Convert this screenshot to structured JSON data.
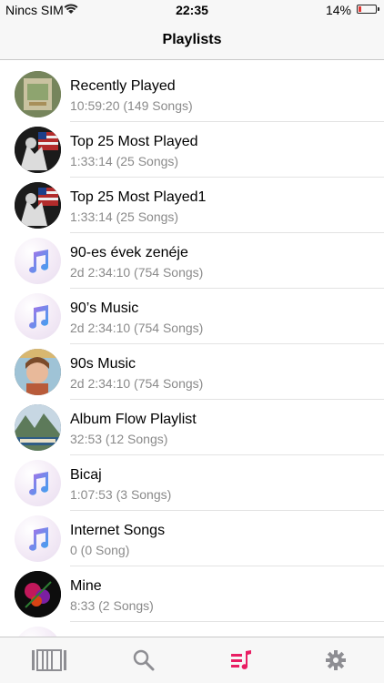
{
  "status_bar": {
    "carrier": "Nincs SIM",
    "time": "22:35",
    "battery_percent": "14%",
    "battery_level": 0.14
  },
  "nav": {
    "title": "Playlists"
  },
  "playlists": [
    {
      "name": "Recently Played",
      "meta": "10:59:20 (149 Songs)",
      "artwork": "photo-art"
    },
    {
      "name": "Top 25 Most Played",
      "meta": "1:33:14 (25 Songs)",
      "artwork": "photo-art"
    },
    {
      "name": "Top 25 Most Played1",
      "meta": "1:33:14 (25 Songs)",
      "artwork": "photo-art"
    },
    {
      "name": "90-es évek zenéje",
      "meta": "2d 2:34:10 (754 Songs)",
      "artwork": "music-note-icon"
    },
    {
      "name": "90’s Music",
      "meta": "2d 2:34:10 (754 Songs)",
      "artwork": "music-note-icon"
    },
    {
      "name": "90s Music",
      "meta": "2d 2:34:10 (754 Songs)",
      "artwork": "photo-art"
    },
    {
      "name": "Album Flow Playlist",
      "meta": "32:53 (12 Songs)",
      "artwork": "photo-art"
    },
    {
      "name": "Bicaj",
      "meta": "1:07:53 (3 Songs)",
      "artwork": "music-note-icon"
    },
    {
      "name": "Internet Songs",
      "meta": "0 (0 Song)",
      "artwork": "music-note-icon"
    },
    {
      "name": "Mine",
      "meta": "8:33 (2 Songs)",
      "artwork": "photo-art"
    }
  ],
  "tab_bar": {
    "tabs": [
      {
        "icon": "library-icon",
        "active": false
      },
      {
        "icon": "search-icon",
        "active": false
      },
      {
        "icon": "playlists-icon",
        "active": true
      },
      {
        "icon": "settings-icon",
        "active": false
      }
    ],
    "active_color": "#e91e63",
    "inactive_color": "#8e8e93"
  }
}
